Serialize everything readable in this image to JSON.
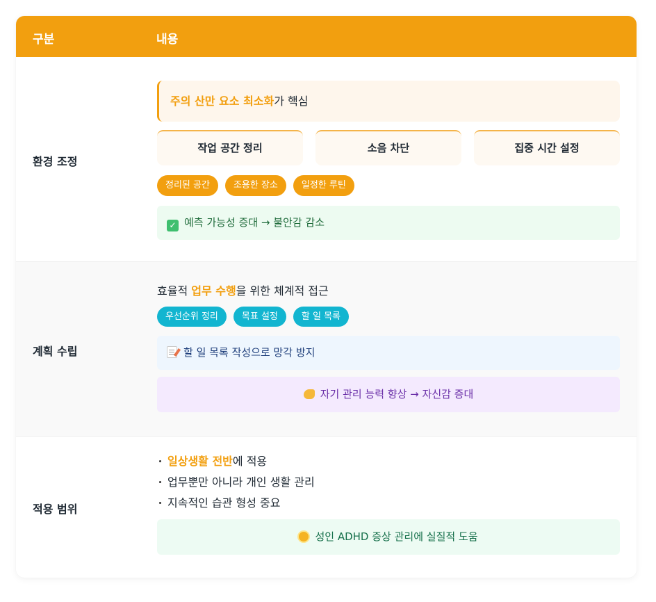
{
  "header": {
    "col1": "구분",
    "col2": "내용"
  },
  "accent_color": "#f29f0f",
  "rows": [
    {
      "label": "환경 조정",
      "callout": {
        "highlight": "주의 산만 요소 최소화",
        "rest": "가 핵심"
      },
      "boxes": [
        "작업 공간 정리",
        "소음 차단",
        "집중 시간 설정"
      ],
      "pills": [
        "정리된 공간",
        "조용한 장소",
        "일정한 루틴"
      ],
      "note": {
        "icon": "check-mark-icon",
        "text": "예측 가능성 증대 → 불안감 감소"
      }
    },
    {
      "label": "계획 수립",
      "intro": {
        "pre": "효율적 ",
        "highlight": "업무 수행",
        "post": "을 위한 체계적 접근"
      },
      "pills": [
        "우선순위 정리",
        "목표 설정",
        "할 일 목록"
      ],
      "note": {
        "icon": "memo-icon",
        "text": "할 일 목록 작성으로 망각 방지"
      },
      "note2": {
        "icon": "flexed-biceps-icon",
        "text": "자기 관리 능력 향상 → 자신감 증대"
      }
    },
    {
      "label": "적용 범위",
      "bullets": [
        {
          "highlight": "일상생활 전반",
          "rest": "에 적용"
        },
        {
          "highlight": "",
          "rest": "업무뿐만 아니라 개인 생활 관리"
        },
        {
          "highlight": "",
          "rest": "지속적인 습관 형성 중요"
        }
      ],
      "note": {
        "icon": "sun-icon",
        "text": "성인 ADHD 증상 관리에 실질적 도움"
      }
    }
  ]
}
